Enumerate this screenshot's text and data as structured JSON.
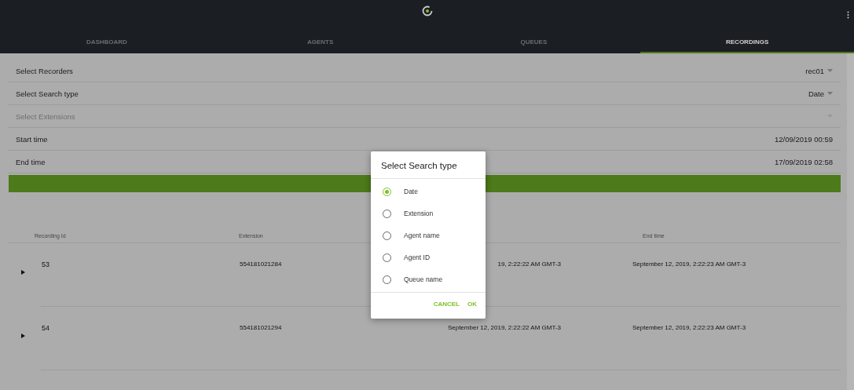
{
  "header": {
    "tabs": [
      {
        "label": "DASHBOARD",
        "selected": false
      },
      {
        "label": "AGENTS",
        "selected": false
      },
      {
        "label": "QUEUES",
        "selected": false
      },
      {
        "label": "RECORDINGS",
        "selected": true
      }
    ]
  },
  "form": {
    "rows": [
      {
        "label": "Select Recorders",
        "value": "rec01",
        "kind": "select",
        "disabled": false
      },
      {
        "label": "Select Search type",
        "value": "Date",
        "kind": "select",
        "disabled": false
      },
      {
        "label": "Select Extensions",
        "kind": "select",
        "disabled": true
      },
      {
        "label": "Start time",
        "value": "12/09/2019 00:59",
        "kind": "text",
        "disabled": false
      },
      {
        "label": "End time",
        "value": "17/09/2019 02:58",
        "kind": "text",
        "disabled": false
      }
    ]
  },
  "table": {
    "columns": [
      {
        "label": "Recording Id"
      },
      {
        "label": "Extension"
      },
      {},
      {
        "label": "End time"
      }
    ],
    "rows": [
      {
        "cells": [
          "53",
          "554181021284",
          "19, 2:22:22 AM GMT-3",
          "September 12, 2019, 2:22:23 AM GMT-3"
        ]
      },
      {
        "cells": [
          "54",
          "554181021294",
          "September 12, 2019, 2:22:22 AM GMT-3",
          "September 12, 2019, 2:22:23 AM GMT-3"
        ]
      }
    ]
  },
  "dialog": {
    "title": "Select Search type",
    "options": [
      {
        "label": "Date",
        "selected": true
      },
      {
        "label": "Extension",
        "selected": false
      },
      {
        "label": "Agent name",
        "selected": false
      },
      {
        "label": "Agent ID",
        "selected": false
      },
      {
        "label": "Queue name",
        "selected": false
      }
    ],
    "buttons": [
      "CANCEL",
      "OK"
    ]
  }
}
